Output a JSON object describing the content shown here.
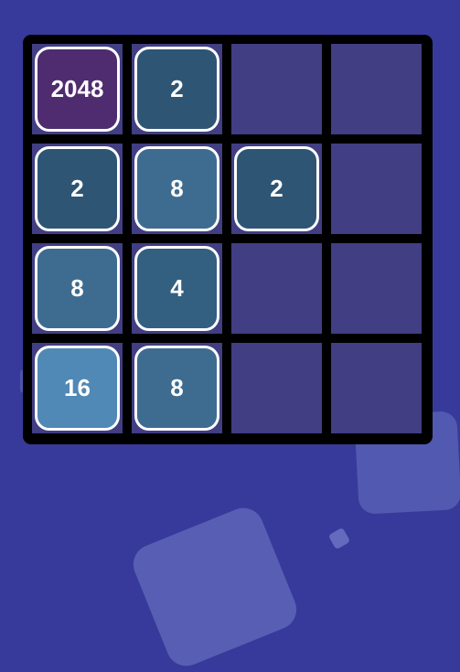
{
  "board": {
    "size": 4,
    "tiles": [
      {
        "row": 0,
        "col": 0,
        "value": "2048",
        "color": "#4f2b6f"
      },
      {
        "row": 0,
        "col": 1,
        "value": "2",
        "color": "#2f5574"
      },
      {
        "row": 1,
        "col": 0,
        "value": "2",
        "color": "#2f5574"
      },
      {
        "row": 1,
        "col": 1,
        "value": "8",
        "color": "#3e6c91"
      },
      {
        "row": 1,
        "col": 2,
        "value": "2",
        "color": "#2f5574"
      },
      {
        "row": 2,
        "col": 0,
        "value": "8",
        "color": "#3e6c91"
      },
      {
        "row": 2,
        "col": 1,
        "value": "4",
        "color": "#335f80"
      },
      {
        "row": 3,
        "col": 0,
        "value": "16",
        "color": "#5088b6"
      },
      {
        "row": 3,
        "col": 1,
        "value": "8",
        "color": "#3e6c91"
      }
    ]
  },
  "colors": {
    "background": "#373a9a",
    "board": "#000000",
    "empty_cell": "#413e83",
    "tile_border": "#ffffff",
    "tile_text": "#ffffff"
  }
}
